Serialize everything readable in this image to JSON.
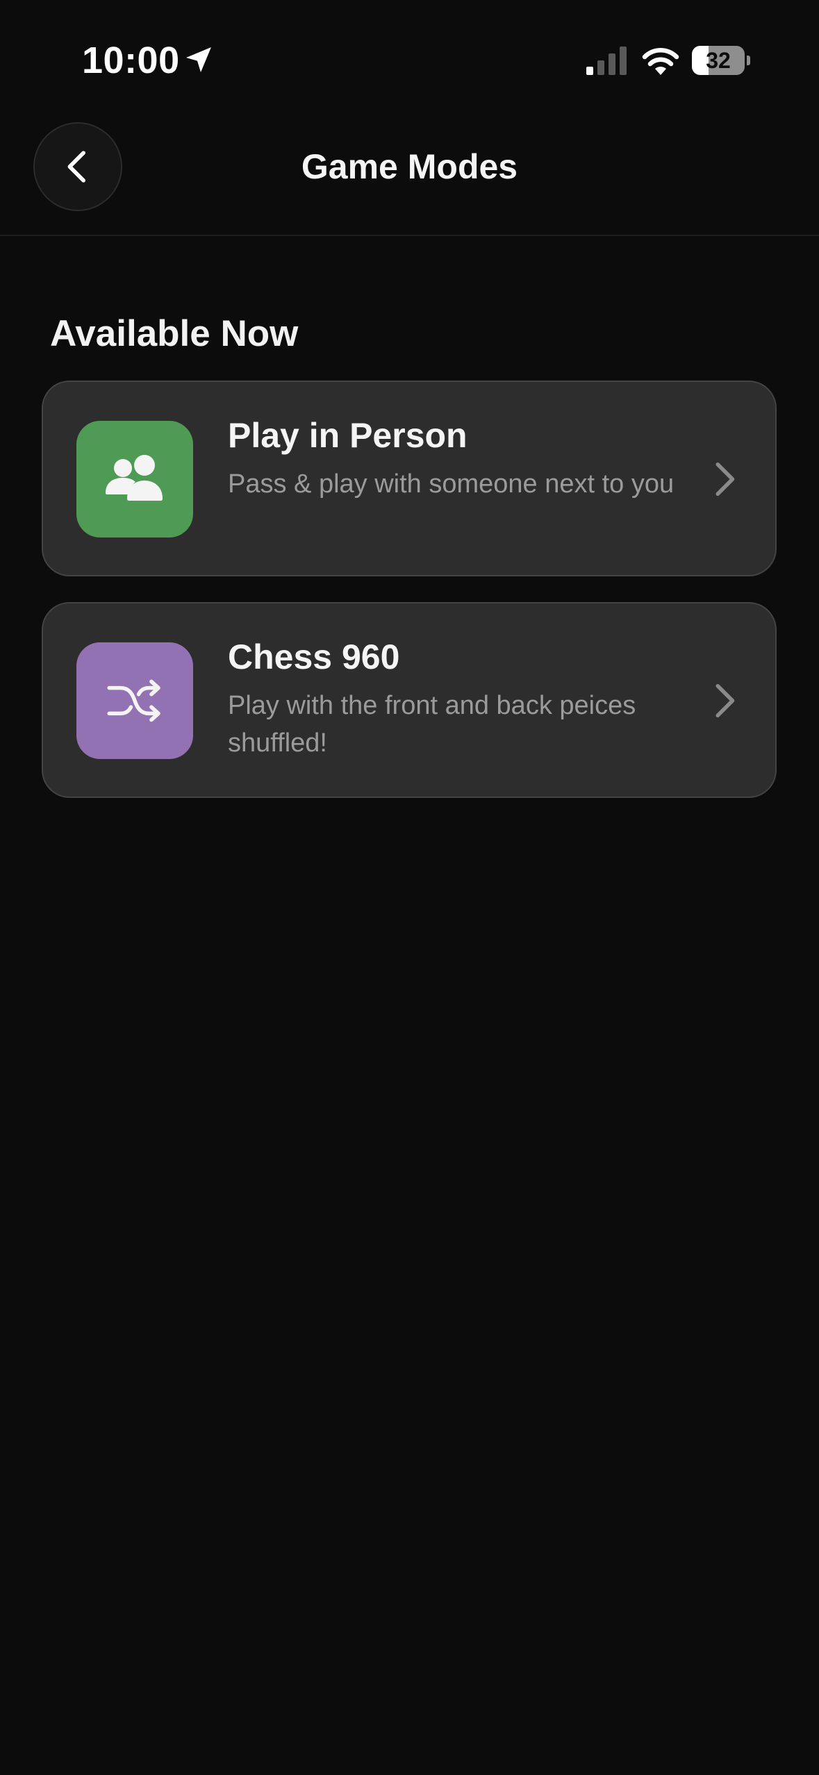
{
  "status_bar": {
    "time": "10:00",
    "battery_level": "32",
    "battery_fraction": 0.32,
    "icons": [
      "location-arrow-icon",
      "cellular-signal-icon",
      "wifi-icon",
      "battery-icon"
    ]
  },
  "nav": {
    "title": "Game Modes",
    "back_icon": "chevron-left-icon"
  },
  "section": {
    "title": "Available Now"
  },
  "modes": [
    {
      "title": "Play in Person",
      "description": "Pass & play with someone next to you",
      "icon": "people-icon",
      "icon_color": "#4f9a55"
    },
    {
      "title": "Chess 960",
      "description": "Play with the front and back peices shuffled!",
      "icon": "shuffle-icon",
      "icon_color": "#9272b3"
    }
  ],
  "colors": {
    "background": "#0c0c0c",
    "card": "#2d2d2d",
    "card_border": "#444444",
    "secondary_text": "#9b9b9b"
  }
}
